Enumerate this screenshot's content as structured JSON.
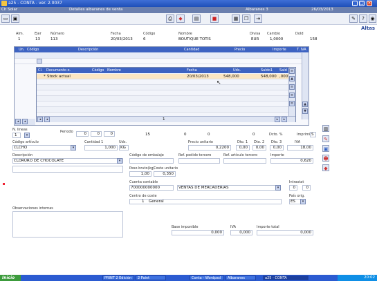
{
  "window": {
    "title": "a25 - CONTA - ver. 2.0037",
    "min": "_",
    "max": "□",
    "close": "×"
  },
  "infobar": {
    "left": "Ch Solar",
    "mid": "Detalles albaranes de venta",
    "right": "Albaranes 3",
    "date": "26/03/2013"
  },
  "toolbar": {
    "mode": "Altas"
  },
  "header": {
    "labels": {
      "alm": "Alm.",
      "ejer": "Ejer",
      "numero": "Número",
      "fecha": "Fecha",
      "codigo": "Código",
      "nombre": "Nombre",
      "divisa": "Divisa",
      "cambio": "Cambio",
      "doid": "DoId"
    },
    "values": {
      "alm": "1",
      "ejer": "13",
      "numero": "113",
      "fecha": "20/03/2013",
      "codigo": "6",
      "nombre": "BOUTIQUE TOTIS",
      "divisa": "EUR",
      "cambio": "1,0000",
      "doid": "158"
    }
  },
  "grid": {
    "headers": [
      "Un.",
      "Código",
      "Descripción",
      "Cantidad",
      "Precio",
      "Importe",
      "T. IVA"
    ],
    "popup_headers": [
      "Cl.",
      "Documento o.",
      "Código",
      "Nombre",
      "Fecha",
      "Uds.",
      "Saldo1",
      "Sald"
    ],
    "popup_row": {
      "cl": "*",
      "doc": "Stock actual",
      "fecha": "20/03/2013",
      "uds": "548,000",
      "saldo": "548,000",
      "sald": ",000"
    },
    "page": "1"
  },
  "detail": {
    "n_lineas_label": "N. lineas",
    "n_lineas": "1",
    "periodo_label": "Periodo",
    "counters": [
      "0",
      "0",
      "0",
      "15",
      "0",
      "0",
      "0"
    ],
    "descuento_label": "Dcto. %",
    "imprimir_label": "Imprimir",
    "imprimir_val": "S",
    "codigo_articulo_label": "Código artículo",
    "codigo_articulo": "CLCHO",
    "cantidad_label": "Cantidad 1",
    "cantidad": "1,000",
    "uds_label": "Uds.",
    "uds": "KG",
    "precio_label": "Precio unitario",
    "precio": "0,2200",
    "dto1_label": "Dto. 1",
    "dto1": "0,00",
    "dto2_label": "Dto. 2",
    "dto2": "0,00",
    "dto3_label": "Dto. 3",
    "dto3": "0,00",
    "iva_label": "IVA",
    "iva": "18,00",
    "descripcion_label": "Descripción",
    "descripcion": "CLORURO DE CHOCOLATE",
    "codigo_embalaje_label": "Código de embalaje",
    "ref_pedido_label": "Ref. pedido tercero",
    "ref_articulo_label": "Ref. artículo tercero",
    "importe_label": "Importe",
    "importe": "0,620",
    "peso_label": "Peso bruto(kg)",
    "coste_label": "Coste unitario",
    "peso": "1,00",
    "coste": "0,350",
    "cuenta_label": "Cuenta contable",
    "cuenta": "700000000000",
    "cuenta_nombre": "VENTAS DE MERCADERIAS",
    "intrastat_label": "Intrastat",
    "intrastat": [
      "0",
      "0"
    ],
    "centro_label": "Centro de coste",
    "centro_num": "1",
    "centro": "General",
    "pais_label": "País orig.",
    "pais": "ES",
    "observaciones_label": "Observaciones internas",
    "base_label": "Base imponible",
    "base": "0,000",
    "iva_total_label": "IVA",
    "iva_total": "0,000",
    "importe_total_label": "Importe total",
    "importe_total": "0,000"
  },
  "taskbar": {
    "start": "Inicio",
    "tasks": [
      "PRINT 2 Edición",
      "2 Paint",
      "Conta - Wordpad",
      "Albaranes",
      "a25 - CONTA"
    ],
    "clock": "20:02"
  }
}
